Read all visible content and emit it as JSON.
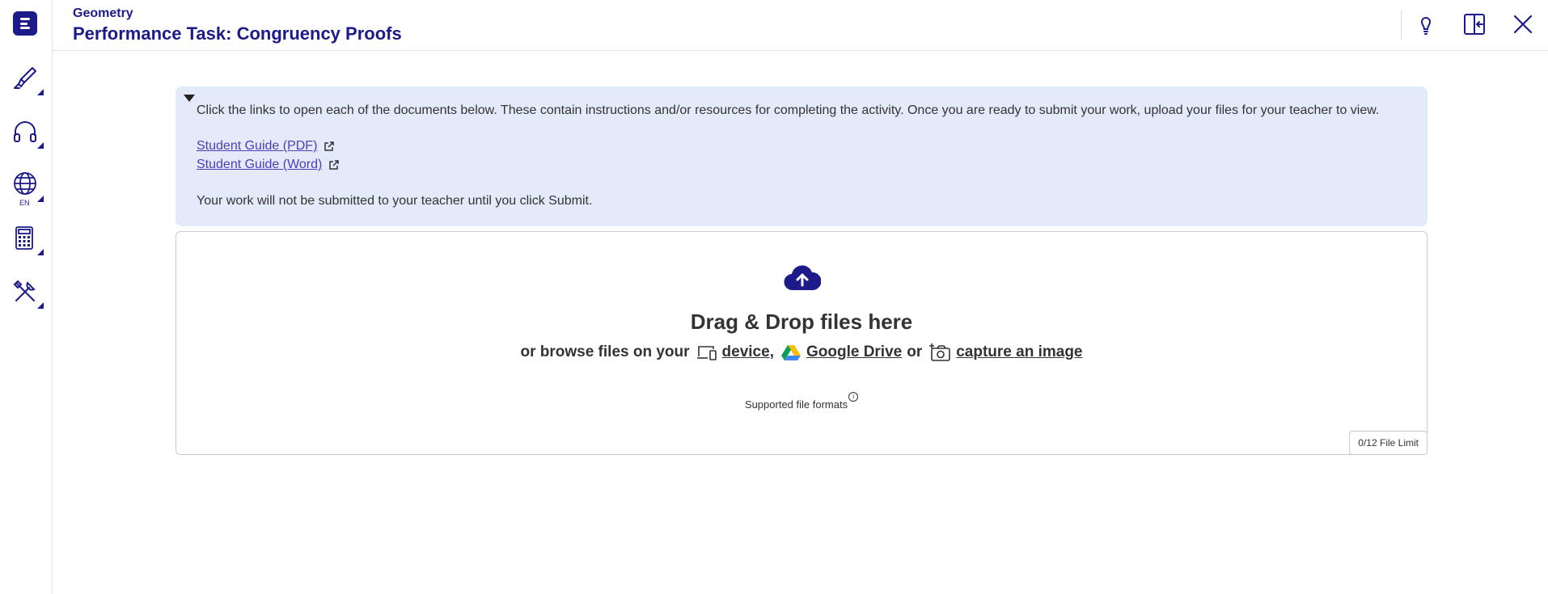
{
  "header": {
    "subject": "Geometry",
    "title": "Performance Task: Congruency Proofs"
  },
  "sidebar": {
    "logo": "edgenuity-logo-icon",
    "tools": [
      {
        "name": "highlighter-icon"
      },
      {
        "name": "headphones-icon"
      },
      {
        "name": "globe-icon",
        "label": "EN"
      },
      {
        "name": "calculator-icon"
      },
      {
        "name": "tools-icon"
      }
    ]
  },
  "header_actions": [
    "lightbulb-icon",
    "collapse-panel-icon",
    "close-icon"
  ],
  "instructions": {
    "text": "Click the links to open each of the documents below. These contain instructions and/or resources for completing the activity. Once you are ready to submit your work, upload your files for your teacher to view.",
    "links": [
      {
        "label": "Student Guide (PDF)"
      },
      {
        "label": "Student Guide (Word)"
      }
    ],
    "notice": "Your work will not be submitted to your teacher until you click Submit."
  },
  "upload": {
    "heading": "Drag & Drop files here",
    "browse_prefix": "or browse files on your",
    "device": "device",
    "comma": ",",
    "google_drive": "Google Drive",
    "or": "or",
    "capture": "capture an image",
    "formats": "Supported file formats",
    "limit": "0/12 File Limit"
  },
  "colors": {
    "brand": "#1d1a8a",
    "info_bg": "#e3ebfb",
    "link": "#4a3fb8"
  }
}
